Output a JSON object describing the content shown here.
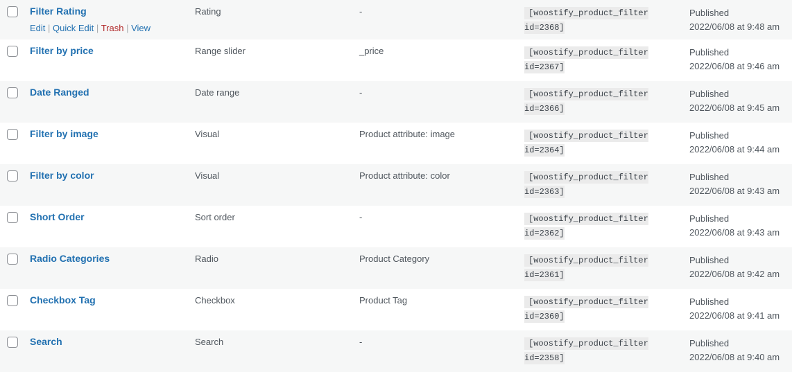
{
  "row_actions": {
    "edit": "Edit",
    "quick_edit": "Quick Edit",
    "trash": "Trash",
    "view": "View",
    "separator": "|"
  },
  "rows": [
    {
      "title": "Filter Rating",
      "type": "Rating",
      "source": "-",
      "shortcode": "[woostify_product_filter id=2368]",
      "status": "Published",
      "date": "2022/06/08 at 9:48 am"
    },
    {
      "title": "Filter by price",
      "type": "Range slider",
      "source": "_price",
      "shortcode": "[woostify_product_filter id=2367]",
      "status": "Published",
      "date": "2022/06/08 at 9:46 am"
    },
    {
      "title": "Date Ranged",
      "type": "Date range",
      "source": "-",
      "shortcode": "[woostify_product_filter id=2366]",
      "status": "Published",
      "date": "2022/06/08 at 9:45 am"
    },
    {
      "title": "Filter by image",
      "type": "Visual",
      "source": "Product attribute: image",
      "shortcode": "[woostify_product_filter id=2364]",
      "status": "Published",
      "date": "2022/06/08 at 9:44 am"
    },
    {
      "title": "Filter by color",
      "type": "Visual",
      "source": "Product attribute: color",
      "shortcode": "[woostify_product_filter id=2363]",
      "status": "Published",
      "date": "2022/06/08 at 9:43 am"
    },
    {
      "title": "Short Order",
      "type": "Sort order",
      "source": "-",
      "shortcode": "[woostify_product_filter id=2362]",
      "status": "Published",
      "date": "2022/06/08 at 9:43 am"
    },
    {
      "title": "Radio Categories",
      "type": "Radio",
      "source": "Product Category",
      "shortcode": "[woostify_product_filter id=2361]",
      "status": "Published",
      "date": "2022/06/08 at 9:42 am"
    },
    {
      "title": "Checkbox Tag",
      "type": "Checkbox",
      "source": "Product Tag",
      "shortcode": "[woostify_product_filter id=2360]",
      "status": "Published",
      "date": "2022/06/08 at 9:41 am"
    },
    {
      "title": "Search",
      "type": "Search",
      "source": "-",
      "shortcode": "[woostify_product_filter id=2358]",
      "status": "Published",
      "date": "2022/06/08 at 9:40 am"
    }
  ]
}
